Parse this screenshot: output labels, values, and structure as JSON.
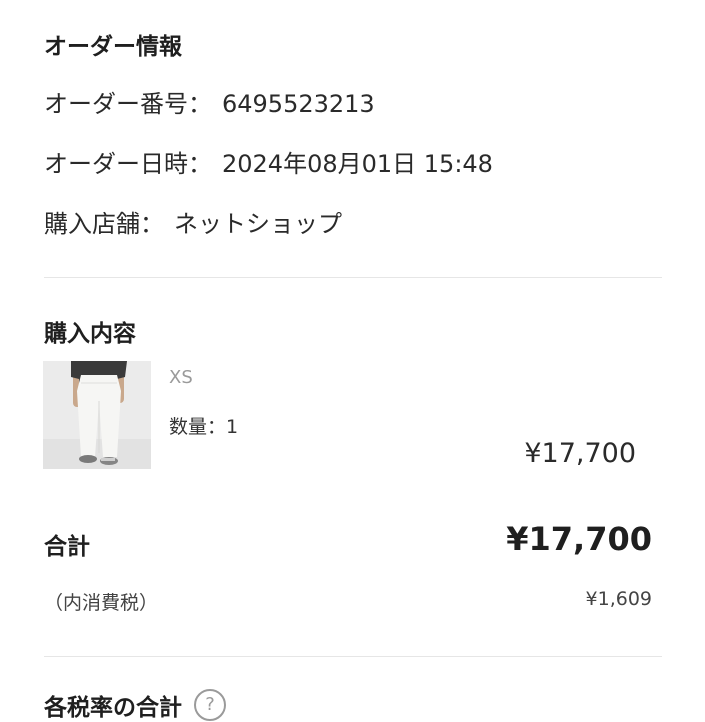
{
  "order_info": {
    "title": "オーダー情報",
    "order_number_label": "オーダー番号：",
    "order_number": "6495523213",
    "order_datetime_label": "オーダー日時：",
    "order_datetime": "2024年08月01日 15:48",
    "store_label": "購入店舗：",
    "store": "ネットショップ"
  },
  "purchase": {
    "title": "購入内容",
    "items": [
      {
        "size": "XS",
        "quantity_label": "数量：",
        "quantity": "1",
        "price": "¥17,700",
        "image_icon": "product-photo-white-pants"
      }
    ]
  },
  "summary": {
    "total_label": "合計",
    "total_value": "¥17,700",
    "tax_label": "（内消費税）",
    "tax_value": "¥1,609"
  },
  "tax_rate": {
    "title": "各税率の合計",
    "help_icon": "question-circle-icon",
    "help_glyph": "?"
  }
}
